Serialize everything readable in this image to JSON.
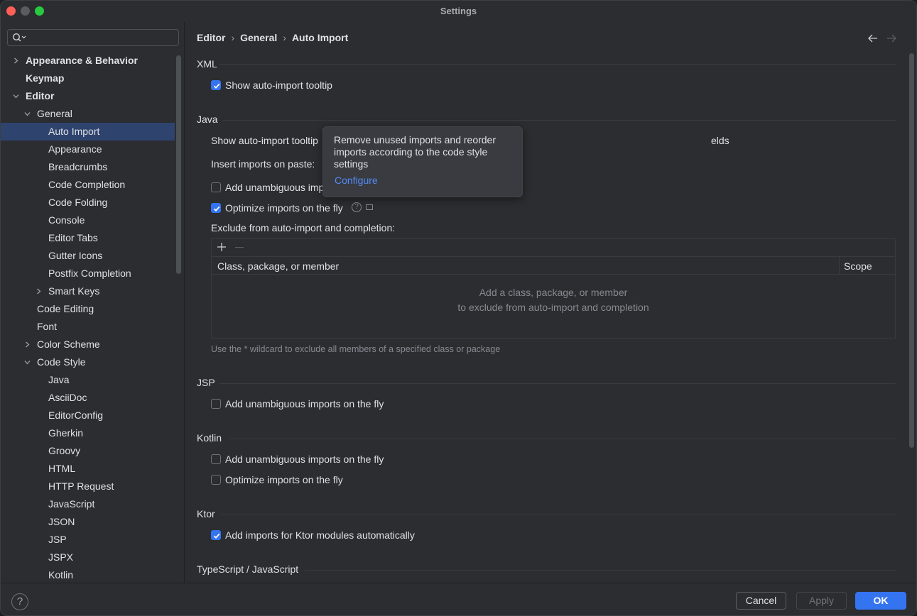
{
  "window": {
    "title": "Settings"
  },
  "search": {
    "placeholder": ""
  },
  "sidebar": {
    "items": [
      {
        "label": "Appearance & Behavior"
      },
      {
        "label": "Keymap"
      },
      {
        "label": "Editor"
      },
      {
        "label": "General"
      },
      {
        "label": "Auto Import"
      },
      {
        "label": "Appearance"
      },
      {
        "label": "Breadcrumbs"
      },
      {
        "label": "Code Completion"
      },
      {
        "label": "Code Folding"
      },
      {
        "label": "Console"
      },
      {
        "label": "Editor Tabs"
      },
      {
        "label": "Gutter Icons"
      },
      {
        "label": "Postfix Completion"
      },
      {
        "label": "Smart Keys"
      },
      {
        "label": "Code Editing"
      },
      {
        "label": "Font"
      },
      {
        "label": "Color Scheme"
      },
      {
        "label": "Code Style"
      },
      {
        "label": "Java"
      },
      {
        "label": "AsciiDoc"
      },
      {
        "label": "EditorConfig"
      },
      {
        "label": "Gherkin"
      },
      {
        "label": "Groovy"
      },
      {
        "label": "HTML"
      },
      {
        "label": "HTTP Request"
      },
      {
        "label": "JavaScript"
      },
      {
        "label": "JSON"
      },
      {
        "label": "JSP"
      },
      {
        "label": "JSPX"
      },
      {
        "label": "Kotlin"
      }
    ]
  },
  "breadcrumb": [
    "Editor",
    "General",
    "Auto Import"
  ],
  "sections": {
    "xml": {
      "title": "XML",
      "show_tooltip": {
        "label": "Show auto-import tooltip",
        "checked": true
      }
    },
    "java": {
      "title": "Java",
      "show_tooltip_label": "Show auto-import tooltip",
      "show_tooltip_suffix": "elds",
      "insert_on_paste_label": "Insert imports on paste:",
      "add_unambiguous": {
        "label": "Add unambiguous imp",
        "checked": false
      },
      "optimize": {
        "label": "Optimize imports on the fly",
        "checked": true
      },
      "exclude_label": "Exclude from auto-import and completion:",
      "table": {
        "col_class": "Class, package, or member",
        "col_scope": "Scope",
        "empty_line1": "Add a class, package, or member",
        "empty_line2": "to exclude from auto-import and completion"
      },
      "hint": "Use the * wildcard to exclude all members of a specified class or package"
    },
    "jsp": {
      "title": "JSP",
      "add_unambiguous": {
        "label": "Add unambiguous imports on the fly",
        "checked": false
      }
    },
    "kotlin": {
      "title": "Kotlin",
      "add_unambiguous": {
        "label": "Add unambiguous imports on the fly",
        "checked": false
      },
      "optimize": {
        "label": "Optimize imports on the fly",
        "checked": false
      }
    },
    "ktor": {
      "title": "Ktor",
      "add_imports": {
        "label": "Add imports for Ktor modules automatically",
        "checked": true
      }
    },
    "ts": {
      "title": "TypeScript / JavaScript"
    }
  },
  "tooltip": {
    "text": "Remove unused imports and reorder imports according to the code style settings",
    "link": "Configure"
  },
  "footer": {
    "help": "?",
    "cancel": "Cancel",
    "apply": "Apply",
    "ok": "OK"
  },
  "colors": {
    "accent": "#3574f0",
    "selection": "#2e436e",
    "link": "#548af7",
    "background": "#2b2d30"
  }
}
